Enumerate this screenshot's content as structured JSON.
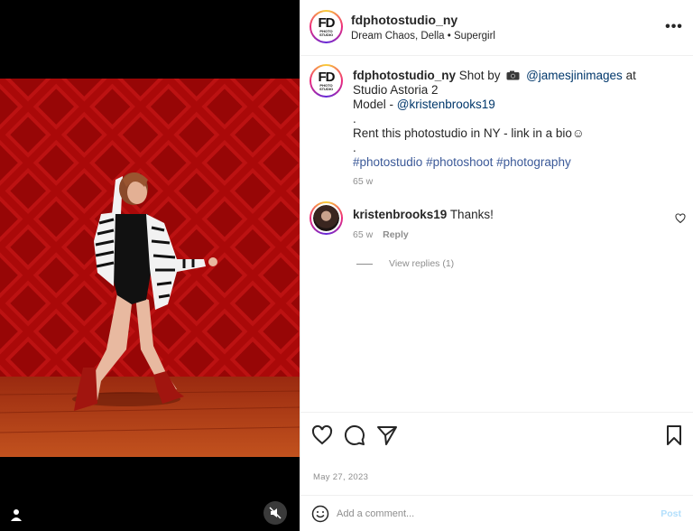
{
  "post": {
    "username": "fdphotostudio_ny",
    "subtitle": "Dream Chaos, Della • Supergirl",
    "avatar_logo_text": "FD",
    "avatar_logo_sub": "PHOTO STUDIO"
  },
  "caption": {
    "username": "fdphotostudio_ny",
    "shot_by_text": "Shot by",
    "photographer": "@jamesjinimages",
    "location_text": "at Studio Astoria 2",
    "model_label": "Model -",
    "model_handle": "@kristenbrooks19",
    "dot1": ".",
    "rent_text": "Rent this photostudio in NY - link in a bio☺",
    "dot2": ".",
    "hashtags": "#photostudio #photoshoot #photography",
    "time": "65 w"
  },
  "comment": {
    "username": "kristenbrooks19",
    "text": "Thanks!",
    "time": "65 w",
    "reply_label": "Reply",
    "view_replies": "View replies (1)"
  },
  "footer": {
    "date": "May 27, 2023",
    "comment_placeholder": "Add a comment...",
    "post_label": "Post"
  },
  "icons": {
    "more": "more-options-icon",
    "like": "heart-icon",
    "comment": "comment-bubble-icon",
    "share": "paper-plane-icon",
    "save": "bookmark-icon",
    "emoji": "smiley-icon",
    "mute": "speaker-muted-icon",
    "tag": "user-tag-icon",
    "camera": "camera-emoji-icon"
  },
  "colors": {
    "link": "#00376b",
    "hashtag": "#3b5998",
    "muted": "#8e8e8e",
    "post_button": "#b2dffc",
    "backdrop_red": "#b01010"
  }
}
